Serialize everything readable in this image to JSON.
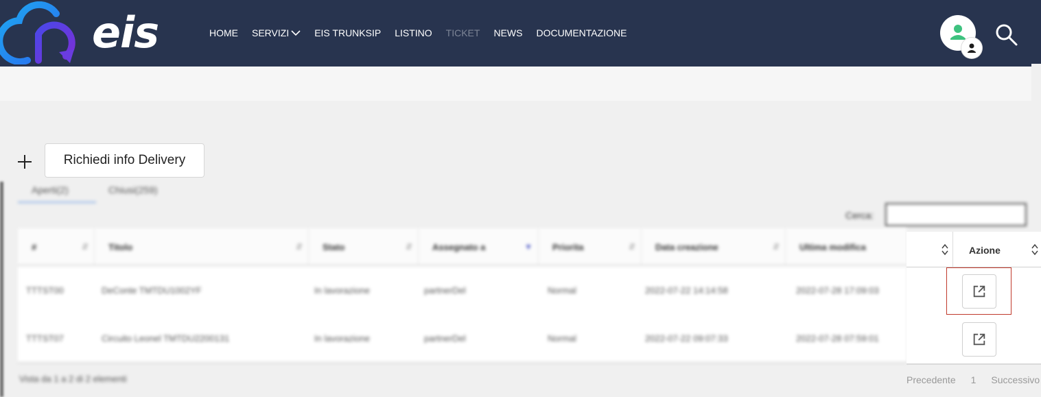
{
  "brand": {
    "name": "eis"
  },
  "nav": {
    "items": [
      {
        "label": "HOME"
      },
      {
        "label": "SERVIZI"
      },
      {
        "label": "EIS TRUNKSIP"
      },
      {
        "label": "LISTINO"
      },
      {
        "label": "TICKET"
      },
      {
        "label": "NEWS"
      },
      {
        "label": "DOCUMENTAZIONE"
      }
    ]
  },
  "toolbar": {
    "request_label": "Richiedi info Delivery"
  },
  "tabs": [
    {
      "label": "Aperti(2)"
    },
    {
      "label": "Chiusi(259)"
    }
  ],
  "search": {
    "label": "Cerca:",
    "value": ""
  },
  "table": {
    "columns": [
      "#",
      "Titolo",
      "Stato",
      "Assegnato a",
      "Priorita",
      "Data creazione",
      "Ultima modifica"
    ],
    "rows": [
      [
        "TTTST00",
        "DeConte TMTDU1002YF",
        "In lavorazione",
        "partnerDel",
        "Normal",
        "2022-07-22 14:14:58",
        "2022-07-28 17:09:03"
      ],
      [
        "TTTST07",
        "Circuito Leonel TMTDU2200131",
        "In lavorazione",
        "partnerDel",
        "Normal",
        "2022-07-22 09:07:33",
        "2022-07-28 07:59:01"
      ]
    ],
    "info": "Vista da 1 a 2 di 2 elementi"
  },
  "action_column": {
    "title": "Azione"
  },
  "pagination": {
    "prev": "Precedente",
    "page": "1",
    "next": "Successivo"
  },
  "colors": {
    "navbar": "#28344f",
    "accent_cyan": "#1e9bea",
    "accent_purple": "#5a3bdc",
    "avatar_green": "#3ec27f",
    "highlight": "#c0392b"
  }
}
